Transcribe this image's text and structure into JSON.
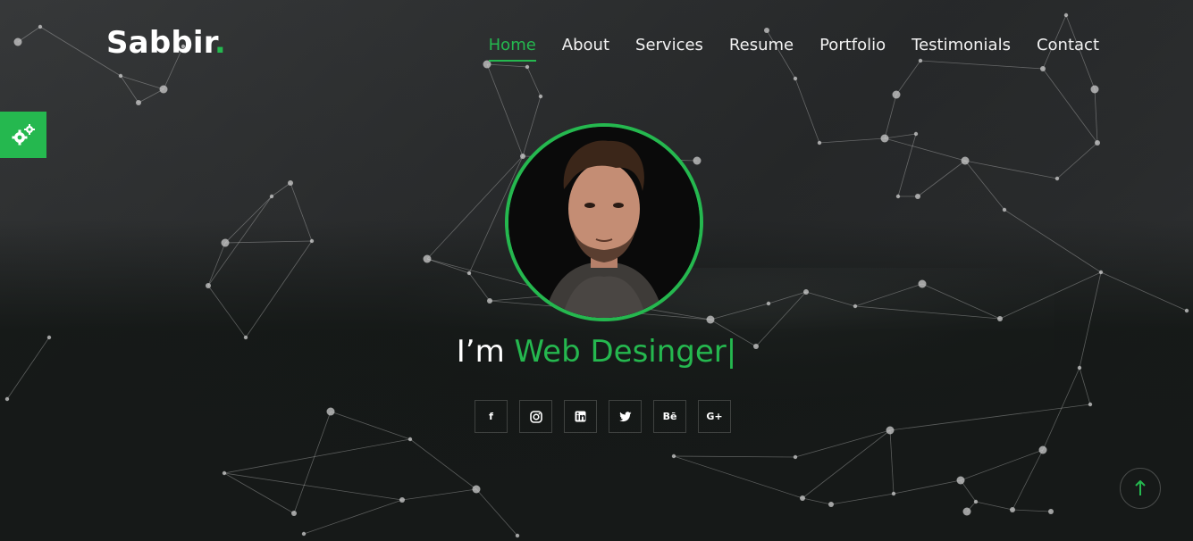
{
  "brand": {
    "name": "Sabbir",
    "dot": ".",
    "accent": "#25b84f"
  },
  "nav": [
    {
      "label": "Home",
      "active": true
    },
    {
      "label": "About"
    },
    {
      "label": "Services"
    },
    {
      "label": "Resume"
    },
    {
      "label": "Portfolio"
    },
    {
      "label": "Testimonials"
    },
    {
      "label": "Contact"
    }
  ],
  "hero": {
    "prefix": "I’m ",
    "role": "Web Desinger",
    "cursor": "|"
  },
  "socials": [
    {
      "name": "facebook-icon",
      "glyph": "f"
    },
    {
      "name": "instagram-icon",
      "glyph": "◎"
    },
    {
      "name": "linkedin-icon",
      "glyph": "in"
    },
    {
      "name": "twitter-icon",
      "glyph": "🐦"
    },
    {
      "name": "behance-icon",
      "glyph": "Bē"
    },
    {
      "name": "google-plus-icon",
      "glyph": "G+"
    }
  ],
  "icons": {
    "settings": "gears-icon",
    "scroll_top": "arrow-up-icon"
  }
}
